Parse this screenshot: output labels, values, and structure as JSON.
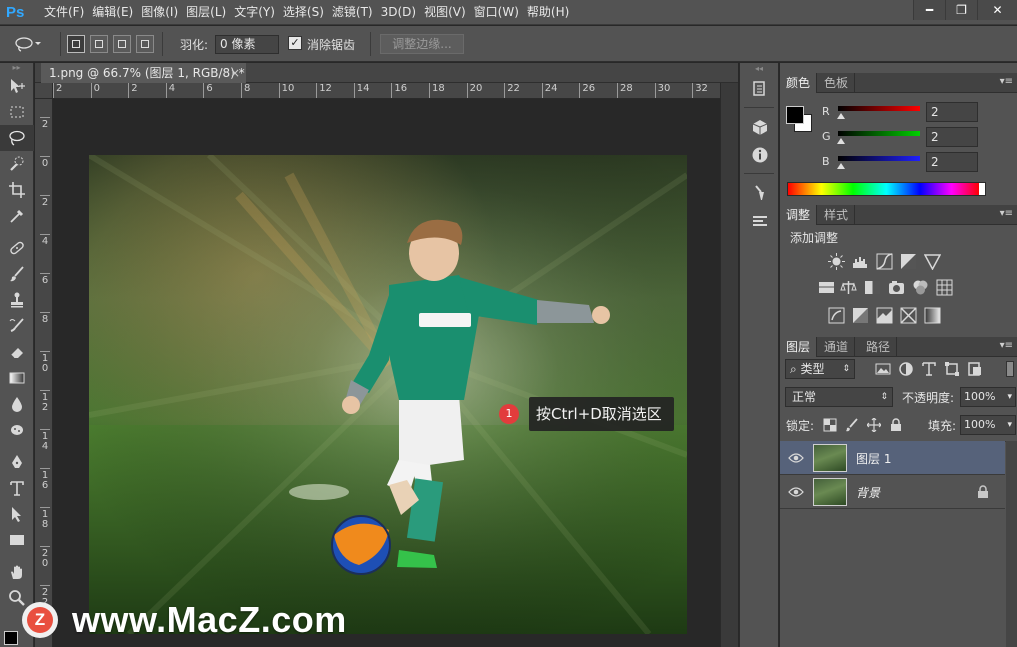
{
  "app": {
    "logo": "Ps"
  },
  "menu": [
    "文件(F)",
    "编辑(E)",
    "图像(I)",
    "图层(L)",
    "文字(Y)",
    "选择(S)",
    "滤镜(T)",
    "3D(D)",
    "视图(V)",
    "窗口(W)",
    "帮助(H)"
  ],
  "window_controls": {
    "minimize": "━",
    "restore": "❐",
    "close": "✕"
  },
  "options": {
    "feather_label": "羽化:",
    "feather_value": "0 像素",
    "antialias_label": "消除锯齿",
    "antialias_checked": true,
    "refine_edge_button": "调整边缘..."
  },
  "document": {
    "tab_title": "1.png @ 66.7% (图层 1, RGB/8) *",
    "tab_close": "×",
    "ruler_h": [
      "2",
      "0",
      "2",
      "4",
      "6",
      "8",
      "10",
      "12",
      "14",
      "16",
      "18",
      "20",
      "22",
      "24",
      "26",
      "28",
      "30",
      "32"
    ],
    "ruler_v": [
      "2",
      "0",
      "2",
      "4",
      "6",
      "8",
      "10",
      "12",
      "14",
      "16",
      "18",
      "20",
      "22"
    ]
  },
  "callout": {
    "number": "1",
    "text": "按Ctrl+D取消选区"
  },
  "watermark": {
    "logo_letter": "Z",
    "text": "www.MacZ.com"
  },
  "color_panel": {
    "tabs": [
      "颜色",
      "色板"
    ],
    "active_tab": "颜色",
    "foreground": "#000000",
    "background": "#ffffff",
    "channels": [
      {
        "letter": "R",
        "value": "2"
      },
      {
        "letter": "G",
        "value": "2"
      },
      {
        "letter": "B",
        "value": "2"
      }
    ]
  },
  "adjust_panel": {
    "tabs": [
      "调整",
      "样式"
    ],
    "active_tab": "调整",
    "title": "添加调整"
  },
  "layers_panel": {
    "tabs": [
      "图层",
      "通道",
      "路径"
    ],
    "active_tab": "图层",
    "filter_kind": "类型",
    "blend_mode": "正常",
    "opacity_label": "不透明度:",
    "opacity_value": "100%",
    "lock_label": "锁定:",
    "fill_label": "填充:",
    "fill_value": "100%",
    "layers": [
      {
        "name": "图层 1",
        "selected": true,
        "locked": false
      },
      {
        "name": "背景",
        "selected": false,
        "locked": true
      }
    ]
  },
  "colors": {
    "ps_blue": "#31a8ff",
    "selection_blue": "#56627a",
    "callout_red": "#e23c3c"
  }
}
